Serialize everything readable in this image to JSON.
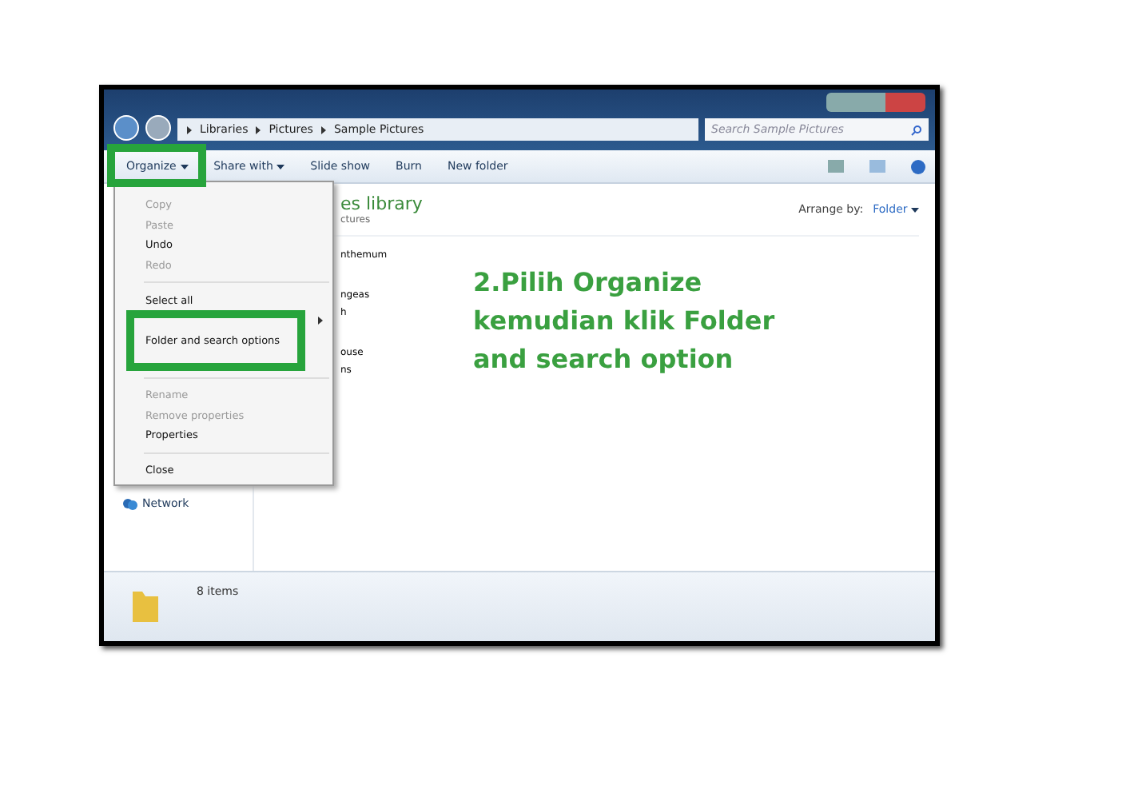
{
  "address": {
    "crumbs": [
      "Libraries",
      "Pictures",
      "Sample Pictures"
    ]
  },
  "search": {
    "placeholder": "Search Sample Pictures"
  },
  "toolbar": {
    "buttons": [
      {
        "label": "Organize",
        "dropdown": true
      },
      {
        "label": "Share with",
        "dropdown": true
      },
      {
        "label": "Slide show",
        "dropdown": false
      },
      {
        "label": "Burn",
        "dropdown": false
      },
      {
        "label": "New folder",
        "dropdown": false
      }
    ]
  },
  "library": {
    "title": "es library",
    "subtitle": "ctures",
    "arrange_label": "Arrange by:",
    "arrange_value": "Folder"
  },
  "files": [
    "nthemum",
    "ngeas",
    "h",
    "ouse",
    "ns"
  ],
  "nav": {
    "items": [
      "Network"
    ]
  },
  "menu": {
    "items": [
      {
        "kind": "item",
        "label": "Copy",
        "disabled": true
      },
      {
        "kind": "item",
        "label": "Paste",
        "disabled": true
      },
      {
        "kind": "item",
        "label": "Undo",
        "disabled": false
      },
      {
        "kind": "item",
        "label": "Redo",
        "disabled": true
      },
      {
        "kind": "separator"
      },
      {
        "kind": "item",
        "label": "Select all",
        "disabled": false
      },
      {
        "kind": "submenu"
      },
      {
        "kind": "item",
        "label": "Folder and search options",
        "disabled": false
      },
      {
        "kind": "blank"
      },
      {
        "kind": "separator"
      },
      {
        "kind": "item",
        "label": "Rename",
        "disabled": true
      },
      {
        "kind": "item",
        "label": "Remove properties",
        "disabled": true
      },
      {
        "kind": "item",
        "label": "Properties",
        "disabled": false
      },
      {
        "kind": "separator"
      },
      {
        "kind": "item",
        "label": "Close",
        "disabled": false
      }
    ]
  },
  "status_bar": {
    "count": "8 items"
  },
  "annotation": {
    "lines": [
      "2.Pilih Organize",
      "kemudian klik Folder",
      "and search option"
    ]
  }
}
